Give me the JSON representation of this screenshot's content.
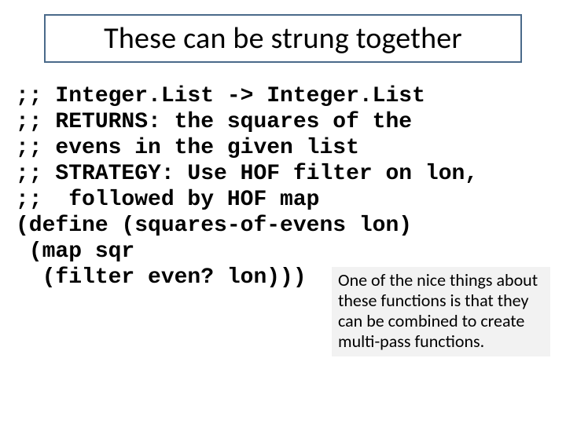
{
  "title": "These can be strung together",
  "code": {
    "l1": ";; Integer.List -> Integer.List",
    "l2": ";; RETURNS: the squares of the",
    "l3": ";; evens in the given list",
    "l4": ";; STRATEGY: Use HOF filter on lon,",
    "l5": ";;  followed by HOF map",
    "l6": "(define (squares-of-evens lon)",
    "l7": " (map sqr",
    "l8": "  (filter even? lon)))"
  },
  "note": "One of the nice things about these functions is that they can be combined to create multi-pass functions."
}
